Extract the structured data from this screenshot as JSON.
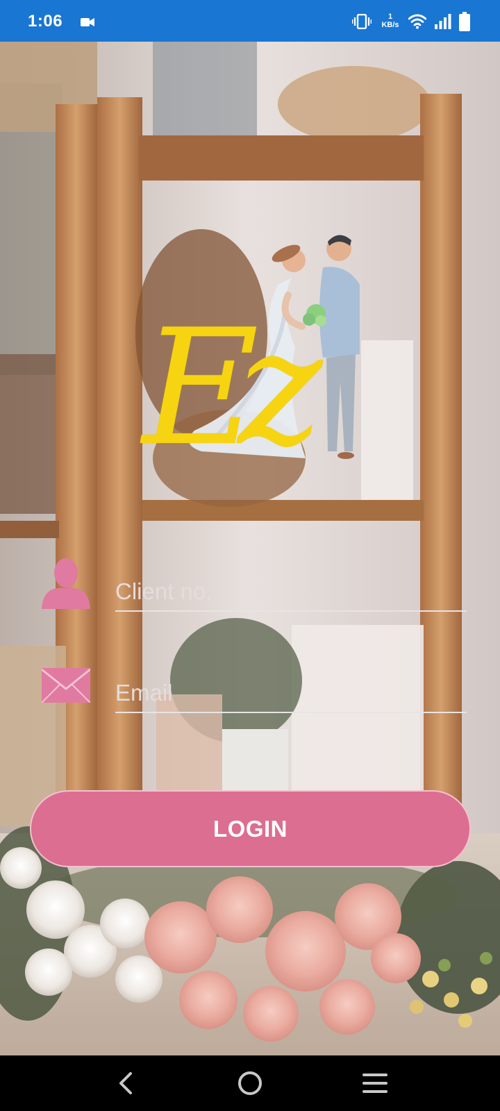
{
  "status_bar": {
    "time": "1:06",
    "network_speed_value": "1",
    "network_speed_unit": "KB/s",
    "icons": [
      "video-camera-icon",
      "vibrate-icon",
      "wifi-icon",
      "signal-icon",
      "battery-icon"
    ]
  },
  "logo": {
    "text": "Ez",
    "color": "#f6d411",
    "illustration": "watercolor wedding couple"
  },
  "form": {
    "client_placeholder": "Client no.",
    "client_value": "",
    "email_placeholder": "Email",
    "email_value": "",
    "login_label": "LOGIN",
    "icon_color": "#e07aa0",
    "button_color": "#dc6e91"
  },
  "nav_bar": {
    "buttons": [
      "back-icon",
      "home-icon",
      "menu-icon"
    ]
  }
}
